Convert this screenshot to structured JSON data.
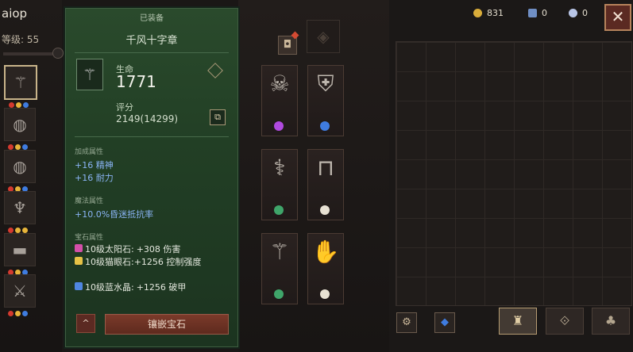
{
  "player": {
    "name": "aiop",
    "level_text": "等级: 55"
  },
  "currencies": [
    {
      "icon": "gold-coin-icon",
      "value": "831"
    },
    {
      "icon": "book-icon",
      "value": "0"
    },
    {
      "icon": "orb-icon",
      "value": "0"
    }
  ],
  "tooltip": {
    "status": "已装备",
    "item_name": "千风十字章",
    "stat_label": "生命",
    "stat_value": "1771",
    "score_label": "评分",
    "score_value": "2149(14299)",
    "sections": {
      "bonus_title": "加成属性",
      "bonus": [
        "+16 精神",
        "+16 耐力"
      ],
      "magic_title": "魔法属性",
      "magic": [
        "+10.0%昏迷抵抗率"
      ],
      "gem_title": "宝石属性",
      "gems": [
        {
          "name": "10级太阳石:",
          "effect": "+308 伤害"
        },
        {
          "name": "10级猫眼石:",
          "effect": "+1256 控制强度"
        },
        {
          "name": "10级蓝水晶:",
          "effect": "+1256 破甲"
        }
      ]
    },
    "collapse_label": "^",
    "socket_button": "镶嵌宝石"
  },
  "close_label": "✕",
  "colors": {
    "panel_green": "#2a4a2c",
    "accent_gold": "#c9b48a",
    "button_red": "#7b3a2a"
  }
}
